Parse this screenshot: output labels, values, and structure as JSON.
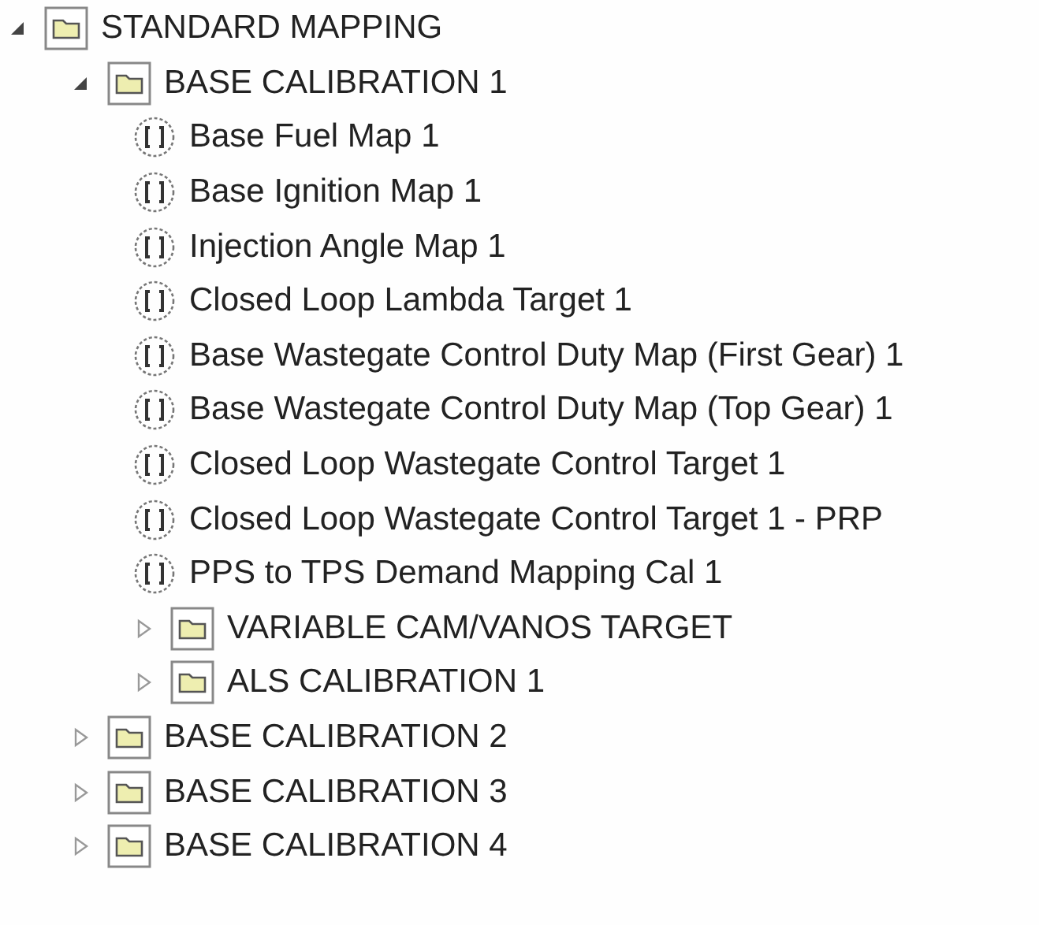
{
  "tree": [
    {
      "kind": "folder",
      "label": "STANDARD MAPPING",
      "expanded": true,
      "children": [
        {
          "kind": "folder",
          "label": "BASE CALIBRATION 1",
          "expanded": true,
          "children": [
            {
              "kind": "map",
              "label": "Base Fuel Map 1"
            },
            {
              "kind": "map",
              "label": "Base Ignition Map 1"
            },
            {
              "kind": "map",
              "label": "Injection Angle Map 1"
            },
            {
              "kind": "map",
              "label": "Closed Loop Lambda Target 1"
            },
            {
              "kind": "map",
              "label": "Base Wastegate Control Duty Map (First Gear) 1"
            },
            {
              "kind": "map",
              "label": "Base Wastegate Control Duty Map (Top Gear) 1"
            },
            {
              "kind": "map",
              "label": "Closed Loop Wastegate Control Target 1"
            },
            {
              "kind": "map",
              "label": "Closed Loop Wastegate Control Target 1 - PRP"
            },
            {
              "kind": "map",
              "label": "PPS to TPS Demand Mapping Cal 1"
            },
            {
              "kind": "folder",
              "label": "VARIABLE CAM/VANOS TARGET",
              "expanded": false
            },
            {
              "kind": "folder",
              "label": "ALS CALIBRATION 1",
              "expanded": false
            }
          ]
        },
        {
          "kind": "folder",
          "label": "BASE CALIBRATION 2",
          "expanded": false
        },
        {
          "kind": "folder",
          "label": "BASE CALIBRATION 3",
          "expanded": false
        },
        {
          "kind": "folder",
          "label": "BASE CALIBRATION 4",
          "expanded": false
        }
      ]
    }
  ]
}
